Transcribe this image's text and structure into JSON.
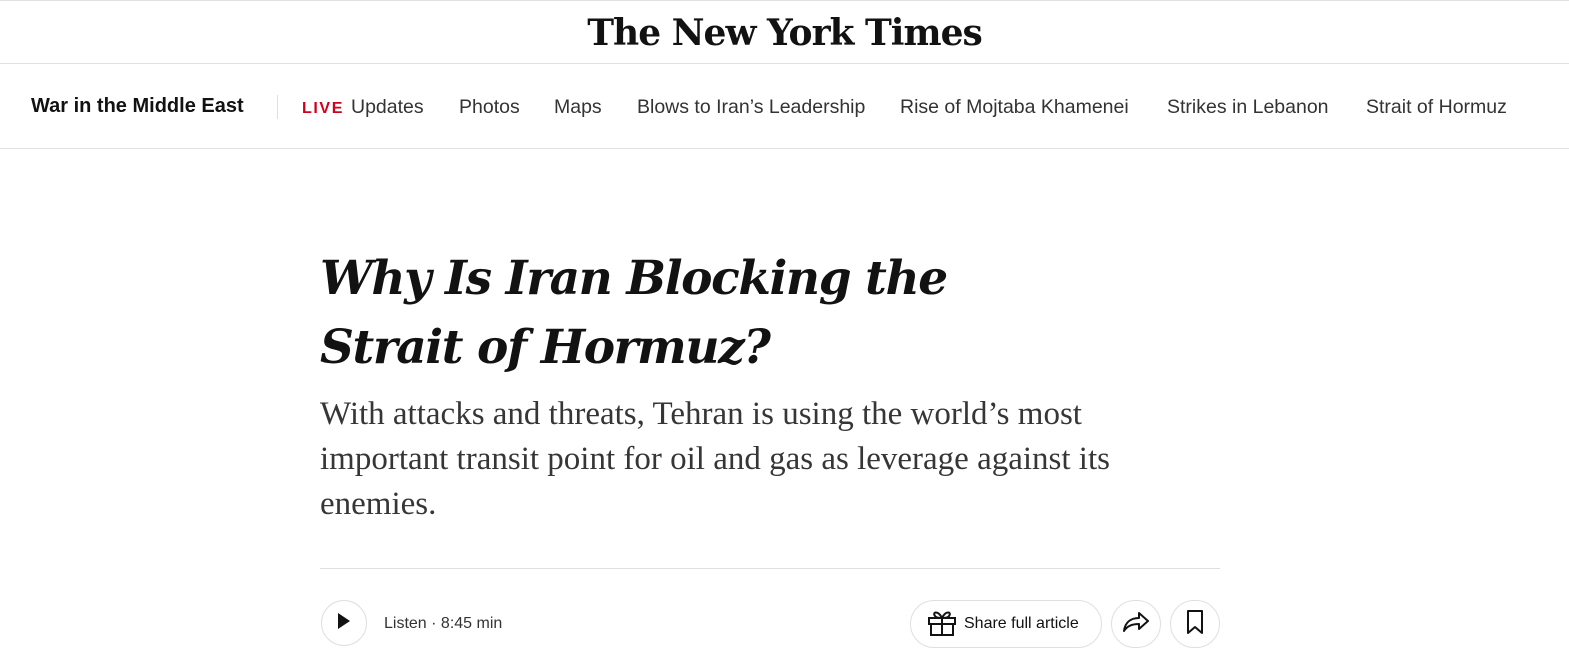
{
  "masthead": {
    "logo_text": "The New York Times"
  },
  "subnav": {
    "section_title": "War in the Middle East",
    "live_label": "LIVE",
    "items": [
      {
        "label": "Updates"
      },
      {
        "label": "Photos"
      },
      {
        "label": "Maps"
      },
      {
        "label": "Blows to Iran’s Leadership"
      },
      {
        "label": "Rise of Mojtaba Khamenei"
      },
      {
        "label": "Strikes in Lebanon"
      },
      {
        "label": "Strait of Hormuz"
      }
    ]
  },
  "article": {
    "headline": "Why Is Iran Blocking the Strait of Hormuz?",
    "summary": "With attacks and threats, Tehran is using the world’s most important transit point for oil and gas as leverage against its enemies."
  },
  "toolbar": {
    "listen_label": "Listen · 8:45 min",
    "share_label": "Share full article"
  },
  "icons": {
    "play": "play-icon",
    "gift": "gift-icon",
    "share": "share-arrow-icon",
    "bookmark": "bookmark-icon"
  },
  "colors": {
    "live_red": "#d0021b",
    "text": "#121212",
    "border": "#dfdfdf"
  }
}
